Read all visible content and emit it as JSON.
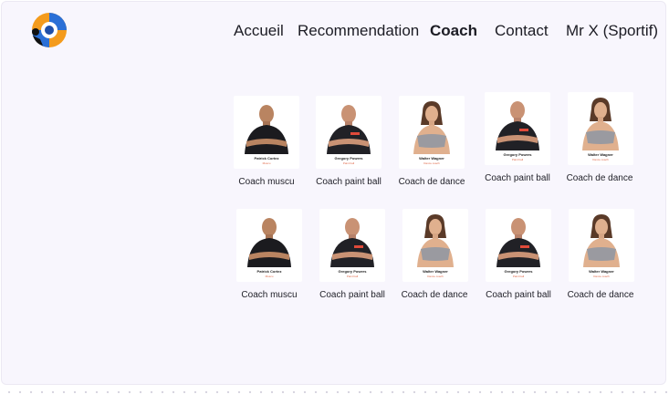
{
  "nav": {
    "home": "Accueil",
    "recommendation": "Recommendation",
    "coach": "Coach",
    "contact": "Contact",
    "user": "Mr X (Sportif)"
  },
  "colors": {
    "accent": "#f07b3f",
    "logo_blue": "#2a6fd6",
    "logo_orange": "#f49b1c"
  },
  "coaches": [
    {
      "name": "Patrick Cortez",
      "role": "Muscu",
      "caption": "Coach muscu",
      "avatar": "male-black-shirt"
    },
    {
      "name": "Gregory Powers",
      "role": "Paint ball",
      "caption": "Coach paint ball",
      "avatar": "male-logo-shirt"
    },
    {
      "name": "Walter Wagner",
      "role": "Dance coach",
      "caption": "Coach de dance",
      "avatar": "female-sports-bra"
    },
    {
      "name": "Gregory Powers",
      "role": "Paint ball",
      "caption": "Coach paint ball",
      "avatar": "male-logo-shirt"
    },
    {
      "name": "Walter Wagner",
      "role": "Dance coach",
      "caption": "Coach de dance",
      "avatar": "female-sports-bra"
    },
    {
      "name": "Patrick Cortez",
      "role": "Muscu",
      "caption": "Coach muscu",
      "avatar": "male-black-shirt"
    },
    {
      "name": "Gregory Powers",
      "role": "Paint ball",
      "caption": "Coach paint ball",
      "avatar": "male-logo-shirt"
    },
    {
      "name": "Walter Wagner",
      "role": "Dance coach",
      "caption": "Coach de dance",
      "avatar": "female-sports-bra"
    },
    {
      "name": "Gregory Powers",
      "role": "Paint ball",
      "caption": "Coach paint ball",
      "avatar": "male-logo-shirt"
    },
    {
      "name": "Walter Wagner",
      "role": "Dance coach",
      "caption": "Coach de dance",
      "avatar": "female-sports-bra"
    }
  ]
}
